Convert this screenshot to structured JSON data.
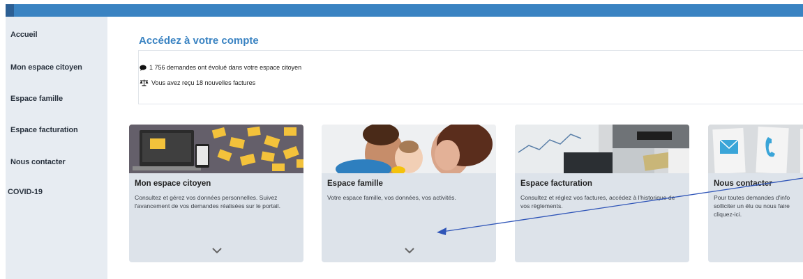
{
  "sidebar": {
    "items": [
      {
        "label": "Accueil"
      },
      {
        "label": "Mon espace citoyen"
      },
      {
        "label": "Espace famille"
      },
      {
        "label": "Espace facturation"
      },
      {
        "label": "Nous contacter"
      },
      {
        "label": "COVID-19"
      }
    ]
  },
  "main": {
    "title": "Accédez à votre compte",
    "notices": [
      {
        "icon": "speech-bubble-icon",
        "text": "1 756 demandes ont évolué dans votre espace citoyen"
      },
      {
        "icon": "scales-icon",
        "text": "Vous avez reçu 18 nouvelles factures"
      }
    ],
    "cards": [
      {
        "title": "Mon espace citoyen",
        "text": "Consultez et gérez vos données personnelles. Suivez l'avancement de vos demandes réalisées sur le portail."
      },
      {
        "title": "Espace famille",
        "text": "Votre espace famille, vos données, vos activités."
      },
      {
        "title": "Espace facturation",
        "text": "Consultez et réglez vos factures, accédez à l'historique de vos règlements."
      },
      {
        "title": "Nous contacter",
        "text": "Pour toutes demandes d'info solliciter un élu ou nous faire cliquez-ici."
      }
    ]
  },
  "colors": {
    "accent": "#3a83c2",
    "sidebar_bg": "#e7ecf2",
    "card_bg": "#dde3ea",
    "annotation_arrow": "#2f55b8"
  }
}
